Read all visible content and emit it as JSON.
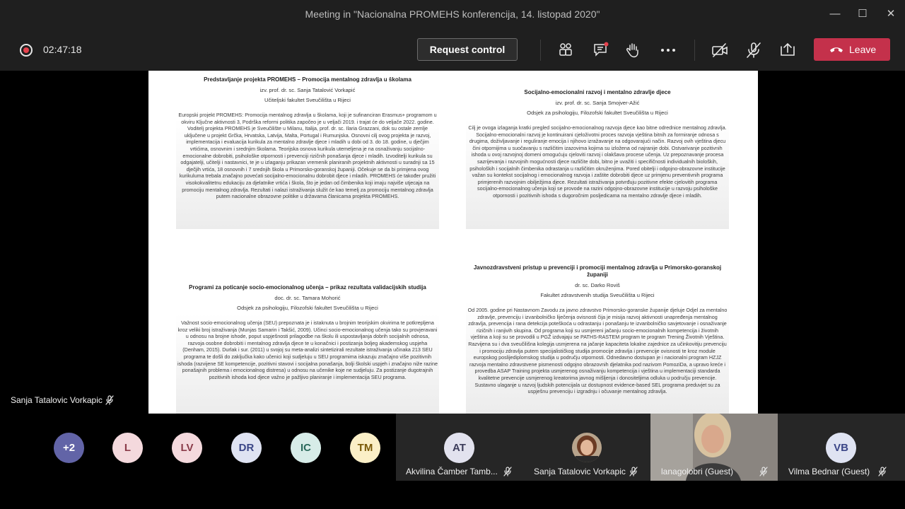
{
  "window": {
    "title": "Meeting in \"Nacionalna PROMEHS konferencija, 14. listopad 2020\""
  },
  "toolbar": {
    "timer": "02:47:18",
    "request_control_label": "Request control",
    "leave_label": "Leave"
  },
  "document": {
    "abstracts": [
      {
        "title": "Predstavljanje projekta PROMEHS – Promocija mentalnog zdravlja u školama",
        "author": "izv. prof. dr. sc. Sanja Tatalović Vorkapić",
        "institution": "Učiteljski fakultet Sveučilišta u Rijeci",
        "body": "Europski projekt PROMEHS: Promocija mentalnog zdravlja u školama, koji je sufinanciran Erasmus+ programom u okviru Ključne aktivnosti 3, Podrška reformi politika započeo je u veljači 2019. i trajat će do veljače 2022. godine. Voditelj projekta PROMEHS je Sveučilište u Milanu, Italija, prof. dr. sc. Ilaria Grazzani, dok su ostale zemlje uključene u projekt Grčka, Hrvatska, Latvija, Malta, Portugal i Rumunjska. Osnovni cilj ovog projekta je razvoj, implementacija i evaluacija kurikula za mentalno zdravlje djece i mladih u dobi od 3. do 18. godine, u dječjim vrtićima, osnovnim i srednjim školama. Teorijska osnova kurikula utemeljena je na osnaživanju socijalno-emocionalne dobrobiti, psihološke otpornosti i prevenciji rizičnih ponašanja djece i mladih. Izvoditelji kurikula su odgajatelji, učitelji i nastavnici, te je u izlaganju prikazan vremenik planiranih projektnih aktivnosti u suradnji sa 15 dječjih vrtića, 18 osnovnih i 7 srednjih škola u Primorsko-goranskoj županiji. Očekuje se da bi primjena ovog kurikuluma trebala značajno povećati socijalno-emocionalnu dobrobit djece i mladih. PROMEHS će također pružiti visokokvalitetnu edukaciju za djelatnike vrtića i škola, što je jedan od čimbenika koji imaju najviše utjecaja na promociju mentalnog zdravlja. Rezultati i nalazi istraživanja služit će kao temelj za promociju mentalnog zdravlja putem nacionalne obrazovne politike u državama članicama projekta PROMEHS."
      },
      {
        "title": "Socijalno-emocionalni razvoj i mentalno zdravlje djece",
        "author": "izv. prof. dr. sc. Sanja Smojver-Ažić",
        "institution": "Odsjek za psihologiju, Filozofski fakultet Sveučilišta u Rijeci",
        "body": "Cilj je ovoga izlaganja kratki pregled socijalno-emocionalnog razvoja djece kao bitne odrednice mentalnog zdravlja. Socijalno-emocionalni razvoj je kontinuirani cjeloživotni proces razvoja vještina bitnih za formiranje odnosa s drugima, doživljavanje i reguliranje emocija i njihovo izražavanje na odgovarajući način. Razvoj ovih vještina djecu čini otpornijima u suočavanju s različitim izazovima kojima su izložena od najranije dobi. Ostvarivanje pozitivnih ishoda u ovoj razvojnoj domeni omogućuju cjeloviti razvoj i olakšava procese učenja. Uz prepoznavanje procesa sazrijevanja i razvojnih mogućnosti djece različite dobi, bitno je uvažiti i specifičnosti individualnih bioloških, psiholoških i socijalnih čimbenika odrastanja u različitim okruženjima. Pored obitelji i odgojno-obrazovne institucije važan su kontekst socijalnog i emocionalnog razvoja i zaštite dobrobiti djece uz primjenu preventivnih programa primjerenih razvojnim obilježjima djece. Rezultati istraživanja potvrđuju pozitivne efekte cjelovitih programa socijalno-emocionalnog učenja koji se provode na razini odgojno-obrazovne institucije u razvoju psihološke otpornosti i pozitivnih ishoda s dugoročnim posljedicama na mentalno zdravlje djece i mladih."
      },
      {
        "title": "Programi za poticanje socio-emocionalnog učenja – prikaz rezultata validacijskih studija",
        "author": "doc. dr. sc. Tamara Mohorić",
        "institution": "Odsjek za psihologiju, Filozofski fakultet Sveučilišta u Rijeci",
        "body": "Važnost socio-emocionalnog učenja (SEU) prepoznata je i istaknuta u brojnim teorijskim okvirima te potkrepljena kroz veliki broj istraživanja (Munjas Samarin i Takšić, 2009). Učinci socio-emocionalnog učenja tako su provjeravani u odnosu na brojne ishode, poput uspješnosti prilagodbe na školu ili uspostavljanja dobrih socijalnih odnosa, razvoja osobne dobrobiti i mentalnog zdravlja djece te u konačnici i postizanja boljeg akademskog uspjeha (Denham, 2015). Durlak i sur. (2011) u svojoj su meta-analizi sintetizirali rezultate istraživanja učinaka 213 SEU programa te došli do zaključka kako učenici koji sudjeluju u SEU programima iskazuju značajno više pozitivnih ishoda (razvijene SE kompetencije, pozitivni stavovi i socijalna ponašanja, bolji školski uspjeh i značajno niže razine ponašajnih problema i emocionalnog distresa) u odnosu na učenike koje ne sudjeluju. Za postizanje dugotrajnih pozitivnih ishoda kod djece važno je pažljivo planiranje i implementacija SEU programa."
      },
      {
        "title": "Javnozdravstveni pristup u prevenciji i promociji mentalnog zdravlja u Primorsko-goranskoj županiji",
        "author": "dr. sc. Darko Roviš",
        "institution": "Fakultet zdravstvenih studija Sveučilišta u Rijeci",
        "body": "Od 2005. godine pri Nastavnom Zavodu za javno zdravstvo Primorsko-goranske županije djeluje Odjel za mentalno zdravlje, prevenciju i izvanbolničko liječenja ovisnosti čija je misija razvoj aktivnosti unapređenja mentalnog zdravlja, prevencija i rana detekcija poteškoća u odrastanju i ponašanju te izvanbolničko savjetovanje i osnaživanje rizičnih i ranjivih skupina. Od programa koji su usmjereni jačanju socio-emocionalnih kompetencija i životnih vještina a koji su se provodili u PGŽ izdvajaju se PATHS-RASTEM program te program Trening Životnih Vještina. Razvijena su i dva sveučilišna kolegija usmjerena na jačanje kapaciteta lokalne zajednice za učinkovitiju prevenciju i promociju zdravlja putem specijalističkog studija promocije zdravlja i prevencije ovisnosti te kroz module europskog poslijediplomskog studija u području otpornosti. Odnedavno dostupan je i nacionalni program HZJZ razvoja mentalno zdravstvene pismenosti odgojno obrazovnih djelatnika pod nazivom PomoziDa, a upravo kreće i provedba ASAP Training projekta usmjerenog osnaživanju kompetencija i vještina u implementaciji standarda kvalitetne prevencije usmjerenog kreatorima javnog mišljenja i donositeljima odluka u području prevencije. Sustavno ulaganje u razvoj ljudskih potencijala uz dostupnost evidence-based SEL programa preduvjet su za uspješnu prevenciju i izgradnju i očuvanje mentalnog zdravlja."
      }
    ]
  },
  "speaker": {
    "name": "Sanja Tatalovic Vorkapic"
  },
  "gallery": {
    "overflow_label": "+2",
    "avatars": [
      {
        "initials": "L",
        "bg": "#f4d9dd",
        "fg": "#8a3b49"
      },
      {
        "initials": "LV",
        "bg": "#f4d9dd",
        "fg": "#8a3b49"
      },
      {
        "initials": "DR",
        "bg": "#dfe3f2",
        "fg": "#3b4687"
      },
      {
        "initials": "IC",
        "bg": "#d7ece8",
        "fg": "#2b6a5c"
      },
      {
        "initials": "TM",
        "bg": "#fbefc7",
        "fg": "#7a5a08"
      }
    ],
    "tiles": [
      {
        "initials": "AT",
        "name": "Akvilina Čamber Tamb..."
      },
      {
        "name": "Sanja Tatalovic Vorkapic"
      },
      {
        "name": "lanagolobri (Guest)"
      },
      {
        "initials": "VB",
        "name": "Vilma Bednar (Guest)"
      }
    ]
  },
  "colors": {
    "leave": "#c4314b",
    "overflow_avatar": "#6264a7",
    "record_dot": "#e5424d"
  }
}
